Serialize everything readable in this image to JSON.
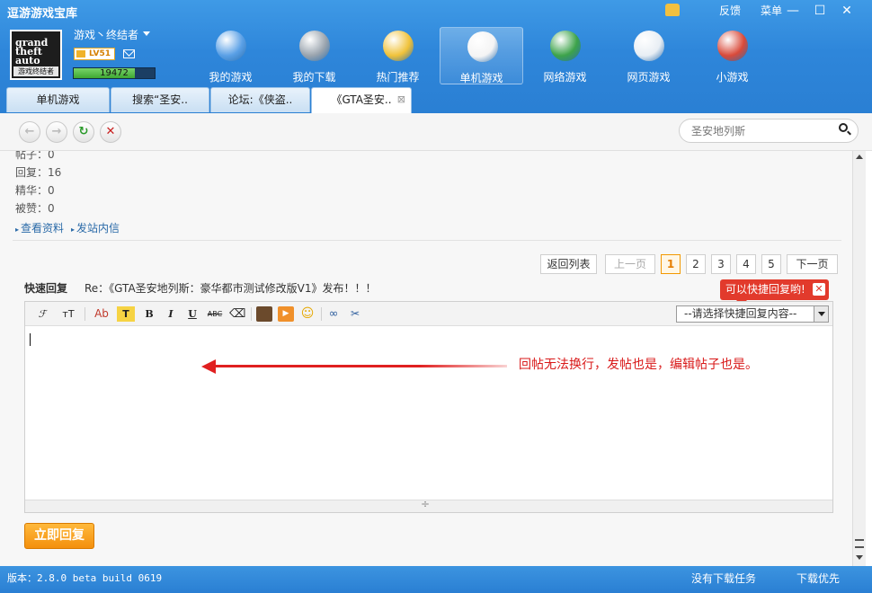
{
  "app": {
    "title": "逗游游戏宝库",
    "top_links": [
      "反馈",
      "菜单"
    ],
    "window_buttons": [
      "—",
      "☐",
      "✕"
    ]
  },
  "user": {
    "name": "游戏丶终结者",
    "level": "LV51",
    "exp_value": "19472",
    "exp_fraction": 0.75,
    "avatar_line1": "grand theft auto",
    "avatar_line2": "游戏终结者"
  },
  "nav": {
    "items": [
      {
        "label": "我的游戏",
        "icon": "person-icon"
      },
      {
        "label": "我的下载",
        "icon": "download-gear-icon"
      },
      {
        "label": "热门推荐",
        "icon": "disc-plus-icon"
      },
      {
        "label": "单机游戏",
        "icon": "gamepad-icon"
      },
      {
        "label": "网络游戏",
        "icon": "globe-sword-icon"
      },
      {
        "label": "网页游戏",
        "icon": "webpage-icon"
      },
      {
        "label": "小游戏",
        "icon": "joystick-icon"
      }
    ],
    "active_index": 3
  },
  "tabs": [
    {
      "label": "单机游戏"
    },
    {
      "label": "搜索“圣安.."
    },
    {
      "label": "论坛:《侠盗.."
    },
    {
      "label": "《GTA圣安.."
    }
  ],
  "toolbar": {
    "search_value": "圣安地列斯",
    "buttons": [
      "back-icon",
      "forward-icon",
      "refresh-icon",
      "stop-icon"
    ]
  },
  "profile": {
    "posts": "帖子：0",
    "replies": "回复：16",
    "elite": "精华：0",
    "likes": "被赞：0",
    "links": [
      "查看资料",
      "发站内信"
    ]
  },
  "pager": {
    "back_to_list": "返回列表",
    "prev": "上一页",
    "pages": [
      "1",
      "2",
      "3",
      "4",
      "5"
    ],
    "current": "1",
    "next": "下一页"
  },
  "quick_reply": {
    "label": "快速回复",
    "title": "Re：《GTA圣安地列斯：豪华都市测试修改版V1》发布！！！",
    "tip": "可以快捷回复哟!",
    "select_value": "--请选择快捷回复内容--",
    "submit": "立即回复",
    "toolbar_labels": {
      "font": "ℱ",
      "size": "тT",
      "color": "Ab",
      "bg": "T",
      "bold": "B",
      "italic": "I",
      "underline": "U",
      "strike": "ABC"
    }
  },
  "annotation": "回帖无法换行，发帖也是，编辑帖子也是。",
  "status": {
    "version": "版本：2.8.0 beta build 0619",
    "tasks": "没有下载任务",
    "priority": "下载优先"
  }
}
